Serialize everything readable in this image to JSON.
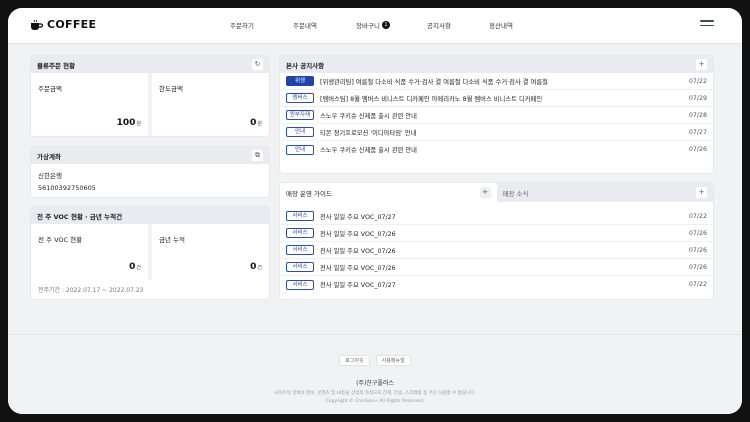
{
  "brand": {
    "name": "COFFEE"
  },
  "nav": [
    {
      "label": "주문하기"
    },
    {
      "label": "주문내역"
    },
    {
      "label": "장바구니",
      "badge": "1"
    },
    {
      "label": "공지사항"
    },
    {
      "label": "정산내역"
    }
  ],
  "logistics": {
    "title": "물류주문 현황",
    "order_label": "주문금액",
    "order_amount": "100",
    "limit_label": "한도금액",
    "limit_amount": "0",
    "unit": "원"
  },
  "virtual_account": {
    "title": "가상계좌",
    "bank": "신한은행",
    "number": "56100392750605"
  },
  "voc": {
    "title": "전 주 VOC 현황 · 금년 누적건",
    "week_label": "전 주 VOC 현황",
    "week_count": "0",
    "year_label": "금년 누적",
    "year_count": "0",
    "unit": "건",
    "period": "전주기간 : 2022.07.17 ~ 2022.07.23"
  },
  "hq_notices": {
    "title": "본사 공지사항",
    "items": [
      {
        "tag": "위생",
        "text": "[위생관리팀] 여름철 다소비 식품 수거·검사 결 여름철 다소비 식품 수거·검사 결 여름철",
        "date": "07/22",
        "solid": true
      },
      {
        "tag": "멤버스",
        "text": "[멤버스팀] 8월 멤버스 비니스트 디카페인 아메리카노 8월 멤버스 비니스트 디카페인",
        "date": "07/29"
      },
      {
        "tag": "원부자재",
        "text": "스노우 쿠키슈 신제품 출시 관련 안내",
        "date": "07/28"
      },
      {
        "tag": "안내",
        "text": "티몬 정기프로모션 '이디야타임' 안내",
        "date": "07/27"
      },
      {
        "tag": "안내",
        "text": "스노우 쿠키슈 신제품 출시 관련 안내",
        "date": "07/26"
      }
    ]
  },
  "guide": {
    "tab_active": "매장 운영 가이드",
    "tab_inactive": "매장 소식",
    "items": [
      {
        "tag": "서비스",
        "text": "전사 일일 주요 VOC_07/27",
        "date": "07/22"
      },
      {
        "tag": "서비스",
        "text": "전사 일일 주요 VOC_07/26",
        "date": "07/26"
      },
      {
        "tag": "서비스",
        "text": "전사 일일 주요 VOC_07/26",
        "date": "07/26"
      },
      {
        "tag": "서비스",
        "text": "전사 일일 주요 VOC_07/26",
        "date": "07/26"
      },
      {
        "tag": "서비스",
        "text": "전사 일일 주요 VOC_07/27",
        "date": "07/22"
      }
    ]
  },
  "footer": {
    "btn_logout": "로그아웃",
    "btn_manual": "사용메뉴얼",
    "company": "(주)찬구플러스",
    "notice": "사이트의 일체의 정보, 콘텐츠 및 UI등을 상업적 목적으로 전재, 전송, 스크래핑 등 무단 사용할 수 없습니다.",
    "copyright": "Copyright © ChinGoo+ All Rights Reserved."
  },
  "colors": {
    "accent": "#1f43a8",
    "header_bg": "#e9ebf0",
    "page_bg": "#f1f2f4"
  }
}
